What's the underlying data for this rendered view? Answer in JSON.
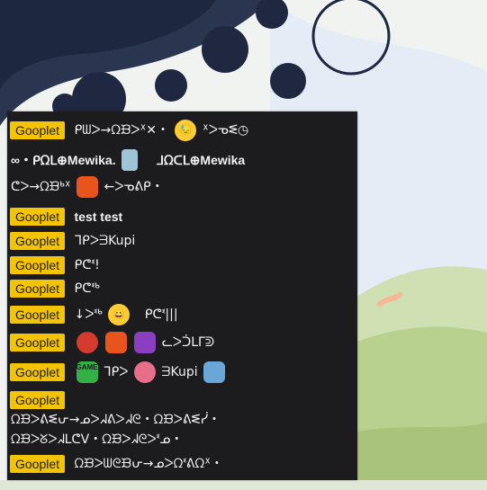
{
  "username": "Gooplet",
  "colors": {
    "badge": "#f5c400",
    "panel": "#1c1c1e",
    "text": "#f2f2f2"
  },
  "messages": [
    {
      "line1": "ᑭᗯᐳ→ᘯᙖᐳᕽ✕・",
      "line1b": "ᕽᐳᓀᓬ◷"
    },
    {
      "line1": "∞・ᑭᘯᒪ⊕Mewika.",
      "line1b": "ᒧᘯᑕᒪ⊕Mewika"
    },
    {
      "line1": "ᕦᐳ→ᘯᙖᒃᕽ",
      "line1b": "←ᐳᓀᕕᑭ・"
    },
    {
      "line1": "test test"
    },
    {
      "line1": "ᒣᑭᐳᗱKupi"
    },
    {
      "line1": "ᑭᕦᓫ!"
    },
    {
      "line1": "ᑭᕦᓫᒃ"
    },
    {
      "line1": "↓ᐳᓫᒃ",
      "line1b": "ᑭᕦᓫ|||"
    },
    {
      "line1": "ᓚᐳᑑᒪᒥᕲ"
    },
    {
      "line1": "ᒣᑭᐳ",
      "line1b": "ᗱKupi"
    },
    {
      "line1": "ᘯᙖᐳᕕᓬᕂ→ᓄᐳᖽᕕᐳᖽᘓ・ᘯᙖᐳᕕᓬᓰ・",
      "line2": "ᘯᙖᐳᘜᐳᖽᒪᕦᐯ・ᘯᙖᐳᖽᘓᐳᓫᓄ・"
    },
    {
      "line1": "ᘯᙖᐳᗯᘓᙖᕂ→ᓄᐳᘯᓫᕕᘯᕽ・"
    }
  ],
  "emotes": {
    "cup": "cup-emote",
    "worried": "worried-emote",
    "angry": "angry-emote",
    "smile": "smile-emote",
    "game_over_text": "GAME OVER"
  }
}
